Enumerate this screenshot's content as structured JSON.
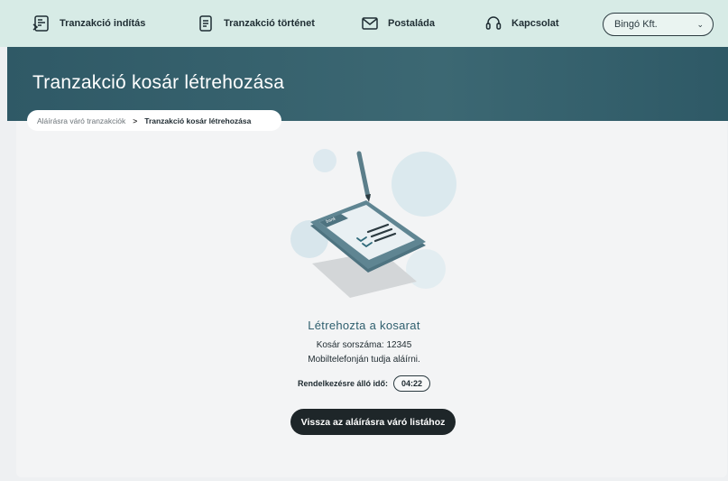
{
  "topbar": {
    "items": [
      {
        "label": "Tranzakció indítás",
        "icon": "transaction-start-icon"
      },
      {
        "label": "Tranzakció történet",
        "icon": "document-icon"
      },
      {
        "label": "Postaláda",
        "icon": "mail-icon"
      },
      {
        "label": "Kapcsolat",
        "icon": "headset-icon"
      }
    ],
    "company_select": {
      "value": "Bingó Kft.",
      "icon": "chevron-down-icon"
    }
  },
  "page": {
    "title": "Tranzakció kosár létrehozása"
  },
  "breadcrumb": {
    "items": [
      {
        "label": "Aláírásra váró tranzakciók"
      },
      {
        "label": "Tranzakció kosár létrehozása"
      }
    ],
    "separator": ">"
  },
  "illustration": {
    "phone_label": "bank"
  },
  "result": {
    "title": "Létrehozta a kosarat",
    "basket_number_line": "Kosár sorszáma: 12345",
    "sign_hint": "Mobiltelefonján tudja aláírni.",
    "time_label": "Rendelkezésre álló idő:",
    "time_value": "04:22",
    "back_button": "Vissza az aláírásra váró listához"
  },
  "colors": {
    "topbar": "#d7ebe6",
    "hero": "#3c6873",
    "accent_text": "#2f5f6e",
    "button": "#1e2629"
  }
}
